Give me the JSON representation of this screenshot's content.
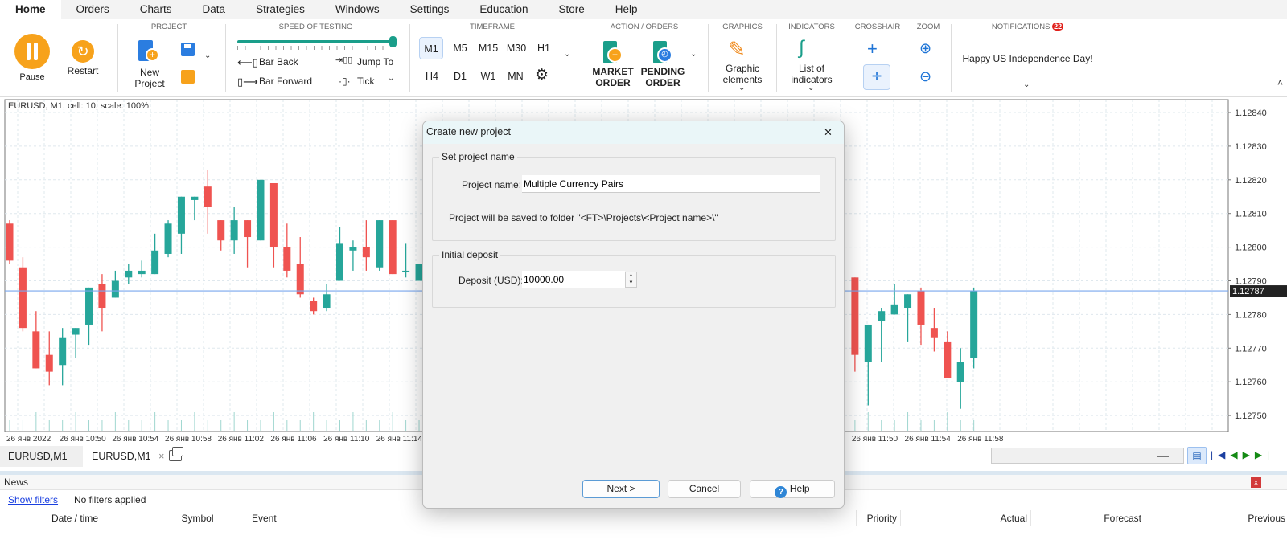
{
  "menu": [
    "Home",
    "Orders",
    "Charts",
    "Data",
    "Strategies",
    "Windows",
    "Settings",
    "Education",
    "Store",
    "Help"
  ],
  "ribbon": {
    "pause": "Pause",
    "restart": "Restart",
    "project": {
      "title": "PROJECT",
      "new_project_l1": "New",
      "new_project_l2": "Project"
    },
    "speed": {
      "title": "SPEED OF TESTING",
      "value_percent": 100,
      "bar_back": "Bar Back",
      "bar_forward": "Bar Forward",
      "jump_to": "Jump To",
      "tick": "Tick"
    },
    "timeframe": {
      "title": "TIMEFRAME",
      "items": [
        "M1",
        "M5",
        "M15",
        "M30",
        "H1",
        "H4",
        "D1",
        "W1",
        "MN"
      ],
      "selected": "M1"
    },
    "orders": {
      "title": "ACTION / ORDERS",
      "market_l1": "MARKET",
      "market_l2": "ORDER",
      "pending_l1": "PENDING",
      "pending_l2": "ORDER"
    },
    "graphics": {
      "title": "GRAPHICS",
      "l1": "Graphic",
      "l2": "elements"
    },
    "indicators": {
      "title": "INDICATORS",
      "l1": "List of",
      "l2": "indicators"
    },
    "crosshair": {
      "title": "CROSSHAIR"
    },
    "zoom": {
      "title": "ZOOM"
    },
    "notifications": {
      "title": "NOTIFICATIONS",
      "count": "22",
      "message": "Happy US Independence Day!"
    }
  },
  "chart": {
    "info": "EURUSD, M1, cell: 10, scale: 100%",
    "current_price": "1.12787"
  },
  "chart_data": {
    "type": "candlestick",
    "symbol": "EURUSD",
    "timeframe": "M1",
    "y_ticks": [
      "1.12840",
      "1.12830",
      "1.12820",
      "1.12810",
      "1.12800",
      "1.12790",
      "1.12780",
      "1.12770",
      "1.12760",
      "1.12750"
    ],
    "ylim": [
      1.12747,
      1.12843
    ],
    "x_ticks": [
      "26 янв 2022",
      "26 янв 10:50",
      "26 янв 10:54",
      "26 янв 10:58",
      "26 янв 11:02",
      "26 янв 11:06",
      "26 янв 11:10",
      "26 янв 11:14",
      "26 янв 11:50",
      "26 янв 11:54",
      "26 янв 11:58"
    ],
    "x_tick_minutes": [
      "10:46",
      "10:50",
      "10:54",
      "10:58",
      "11:02",
      "11:06",
      "11:10",
      "11:14",
      "11:50",
      "11:54",
      "11:58"
    ],
    "current_price": 1.12787,
    "bull_color": "#26a69a",
    "bear_color": "#ef5350",
    "candles": [
      {
        "t": "10:46",
        "o": 1.12807,
        "h": 1.12808,
        "l": 1.12795,
        "c": 1.12796
      },
      {
        "t": "10:47",
        "o": 1.12794,
        "h": 1.12797,
        "l": 1.12775,
        "c": 1.12776
      },
      {
        "t": "10:48",
        "o": 1.12775,
        "h": 1.12781,
        "l": 1.12764,
        "c": 1.12764
      },
      {
        "t": "10:49",
        "o": 1.12768,
        "h": 1.12775,
        "l": 1.12759,
        "c": 1.12763
      },
      {
        "t": "10:50",
        "o": 1.12765,
        "h": 1.12776,
        "l": 1.12759,
        "c": 1.12773
      },
      {
        "t": "10:51",
        "o": 1.12774,
        "h": 1.12776,
        "l": 1.12767,
        "c": 1.12776
      },
      {
        "t": "10:52",
        "o": 1.12777,
        "h": 1.12788,
        "l": 1.12771,
        "c": 1.12788
      },
      {
        "t": "10:53",
        "o": 1.12789,
        "h": 1.12792,
        "l": 1.12775,
        "c": 1.12782
      },
      {
        "t": "10:54",
        "o": 1.12785,
        "h": 1.12793,
        "l": 1.12785,
        "c": 1.1279
      },
      {
        "t": "10:55",
        "o": 1.12791,
        "h": 1.12795,
        "l": 1.12789,
        "c": 1.12793
      },
      {
        "t": "10:56",
        "o": 1.12792,
        "h": 1.12796,
        "l": 1.12791,
        "c": 1.12793
      },
      {
        "t": "10:57",
        "o": 1.12792,
        "h": 1.12804,
        "l": 1.12792,
        "c": 1.12799
      },
      {
        "t": "10:58",
        "o": 1.12798,
        "h": 1.12808,
        "l": 1.12797,
        "c": 1.12807
      },
      {
        "t": "10:59",
        "o": 1.12804,
        "h": 1.12815,
        "l": 1.12798,
        "c": 1.12815
      },
      {
        "t": "11:00",
        "o": 1.12814,
        "h": 1.12815,
        "l": 1.12808,
        "c": 1.12815
      },
      {
        "t": "11:01",
        "o": 1.12818,
        "h": 1.12823,
        "l": 1.12804,
        "c": 1.12812
      },
      {
        "t": "11:02",
        "o": 1.12808,
        "h": 1.12808,
        "l": 1.12799,
        "c": 1.12802
      },
      {
        "t": "11:03",
        "o": 1.12802,
        "h": 1.12812,
        "l": 1.12798,
        "c": 1.12808
      },
      {
        "t": "11:04",
        "o": 1.12808,
        "h": 1.12808,
        "l": 1.12794,
        "c": 1.12803
      },
      {
        "t": "11:05",
        "o": 1.12802,
        "h": 1.1282,
        "l": 1.12802,
        "c": 1.1282
      },
      {
        "t": "11:06",
        "o": 1.12819,
        "h": 1.12819,
        "l": 1.12794,
        "c": 1.128
      },
      {
        "t": "11:07",
        "o": 1.128,
        "h": 1.12807,
        "l": 1.12791,
        "c": 1.12793
      },
      {
        "t": "11:08",
        "o": 1.12795,
        "h": 1.12803,
        "l": 1.12785,
        "c": 1.12786
      },
      {
        "t": "11:09",
        "o": 1.12784,
        "h": 1.12785,
        "l": 1.1278,
        "c": 1.12781
      },
      {
        "t": "11:10",
        "o": 1.12782,
        "h": 1.12789,
        "l": 1.12781,
        "c": 1.12786
      },
      {
        "t": "11:11",
        "o": 1.1279,
        "h": 1.12806,
        "l": 1.1279,
        "c": 1.12801
      },
      {
        "t": "11:12",
        "o": 1.12799,
        "h": 1.12802,
        "l": 1.12793,
        "c": 1.128
      },
      {
        "t": "11:13",
        "o": 1.128,
        "h": 1.12808,
        "l": 1.12793,
        "c": 1.12797
      },
      {
        "t": "11:14",
        "o": 1.12794,
        "h": 1.12808,
        "l": 1.12793,
        "c": 1.12808
      },
      {
        "t": "11:15",
        "o": 1.12808,
        "h": 1.12808,
        "l": 1.12792,
        "c": 1.12792
      },
      {
        "t": "11:16",
        "o": 1.12793,
        "h": 1.12801,
        "l": 1.12791,
        "c": 1.12793
      },
      {
        "t": "11:17",
        "o": 1.1279,
        "h": 1.12795,
        "l": 1.1279,
        "c": 1.12795
      },
      {
        "t": "11:50",
        "o": 1.12791,
        "h": 1.12791,
        "l": 1.12763,
        "c": 1.12768
      },
      {
        "t": "11:51",
        "o": 1.12766,
        "h": 1.12777,
        "l": 1.12753,
        "c": 1.12777
      },
      {
        "t": "11:52",
        "o": 1.12778,
        "h": 1.12782,
        "l": 1.12766,
        "c": 1.12781
      },
      {
        "t": "11:53",
        "o": 1.1278,
        "h": 1.12789,
        "l": 1.1278,
        "c": 1.12783
      },
      {
        "t": "11:54",
        "o": 1.12782,
        "h": 1.12786,
        "l": 1.12772,
        "c": 1.12786
      },
      {
        "t": "11:55",
        "o": 1.12787,
        "h": 1.12788,
        "l": 1.12771,
        "c": 1.12777
      },
      {
        "t": "11:56",
        "o": 1.12776,
        "h": 1.12782,
        "l": 1.12769,
        "c": 1.12773
      },
      {
        "t": "11:57",
        "o": 1.12772,
        "h": 1.12775,
        "l": 1.12761,
        "c": 1.12761
      },
      {
        "t": "11:58",
        "o": 1.1276,
        "h": 1.1277,
        "l": 1.12752,
        "c": 1.12766
      },
      {
        "t": "11:59",
        "o": 1.12767,
        "h": 1.12788,
        "l": 1.12764,
        "c": 1.12787
      }
    ]
  },
  "tabs": [
    {
      "label": "EURUSD,M1"
    },
    {
      "label": "EURUSD,M1",
      "close": "×"
    }
  ],
  "news": {
    "title": "News",
    "show_filters": "Show filters",
    "filter_status": "No filters applied",
    "close": "x",
    "columns": [
      "Date / time",
      "Symbol",
      "Event",
      "Priority",
      "Actual",
      "Forecast",
      "Previous"
    ]
  },
  "dialog": {
    "title": "Create new project",
    "close": "✕",
    "group1": "Set project name",
    "project_name_label": "Project name:",
    "project_name_value": "Multiple Currency Pairs",
    "save_note": "Project will be saved to folder \"<FT>\\Projects\\<Project name>\\\"",
    "group2": "Initial deposit",
    "deposit_label": "Deposit (USD):",
    "deposit_value": "10000.00",
    "next": "Next >",
    "cancel": "Cancel",
    "help": "Help"
  },
  "colors": {
    "accent": "#f7a21b",
    "teal": "#1a9e8a",
    "blue": "#1e74d6",
    "price_line": "#7aa7ee",
    "badge": "#e0201b"
  }
}
